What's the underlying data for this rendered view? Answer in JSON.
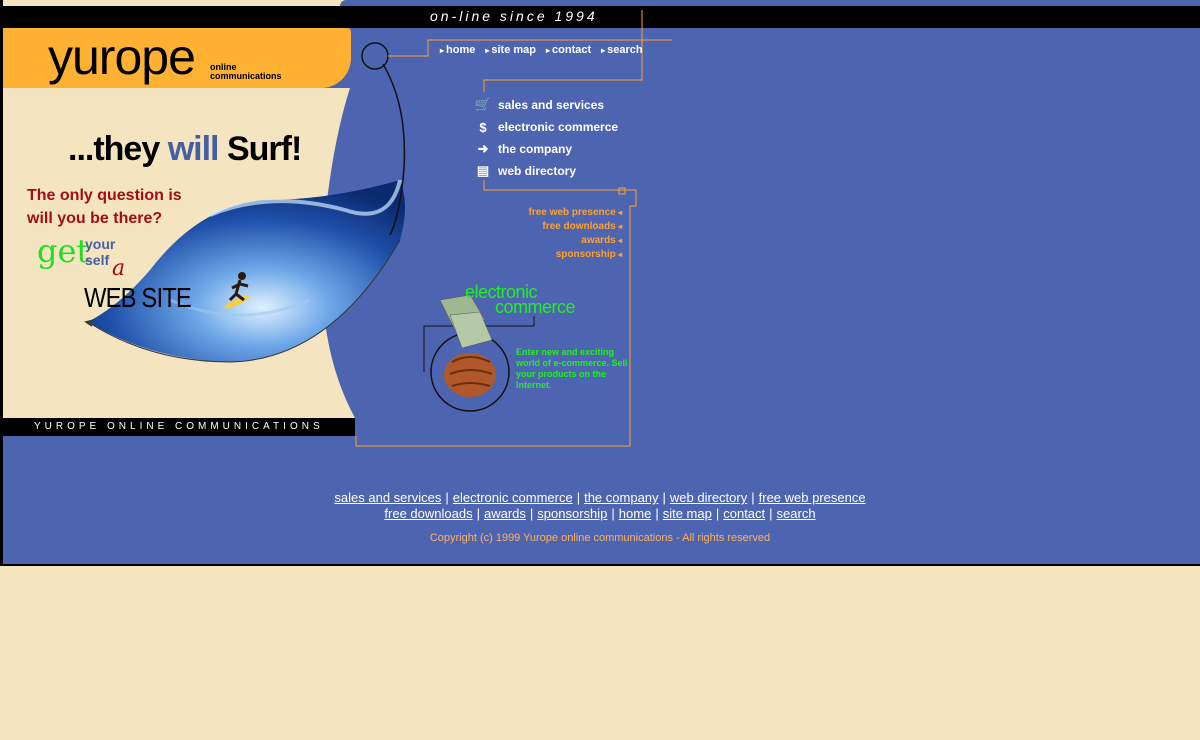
{
  "header": {
    "tagline": "on-line since 1994"
  },
  "logo": {
    "name": "yurope",
    "sub_line1": "online",
    "sub_line2": "communications"
  },
  "left_panel": {
    "headline_pre": "...they ",
    "headline_will": "will",
    "headline_post": " Surf!",
    "question_line1": "The only question is",
    "question_line2": "will you be there?",
    "get": "get",
    "your": "your",
    "self": "self",
    "a": "a",
    "website": "WEB SITE",
    "footer_bar": "YUROPE ONLINE COMMUNICATIONS"
  },
  "top_nav": [
    "home",
    "site map",
    "contact",
    "search"
  ],
  "main_menu": [
    {
      "icon": "cart-icon",
      "label": "sales and services"
    },
    {
      "icon": "dollar-icon",
      "label": "electronic commerce"
    },
    {
      "icon": "arrow-right-icon",
      "label": "the company"
    },
    {
      "icon": "directory-icon",
      "label": "web directory"
    }
  ],
  "orange_menu": [
    "free web presence",
    "free downloads",
    "awards",
    "sponsorship"
  ],
  "ecommerce": {
    "title_line1": "electronic",
    "title_line2": "commerce",
    "description": "Enter new and exciting world of e-commerce. Sell your products on the Internet."
  },
  "footer": {
    "links_row1": [
      "sales and services",
      "electronic commerce",
      "the company",
      "web directory",
      "free web presence"
    ],
    "links_row2": [
      "free downloads",
      "awards",
      "sponsorship",
      "home",
      "site map",
      "contact",
      "search"
    ],
    "separator": "|",
    "copyright": "Copyright (c) 1999 Yurope online communications - All rights reserved"
  },
  "colors": {
    "blue": "#4d65b0",
    "cream": "#f4e5c0",
    "orange": "#ffb133",
    "accent_orange": "#ffa030",
    "green": "#22ee22",
    "red": "#a01010"
  }
}
